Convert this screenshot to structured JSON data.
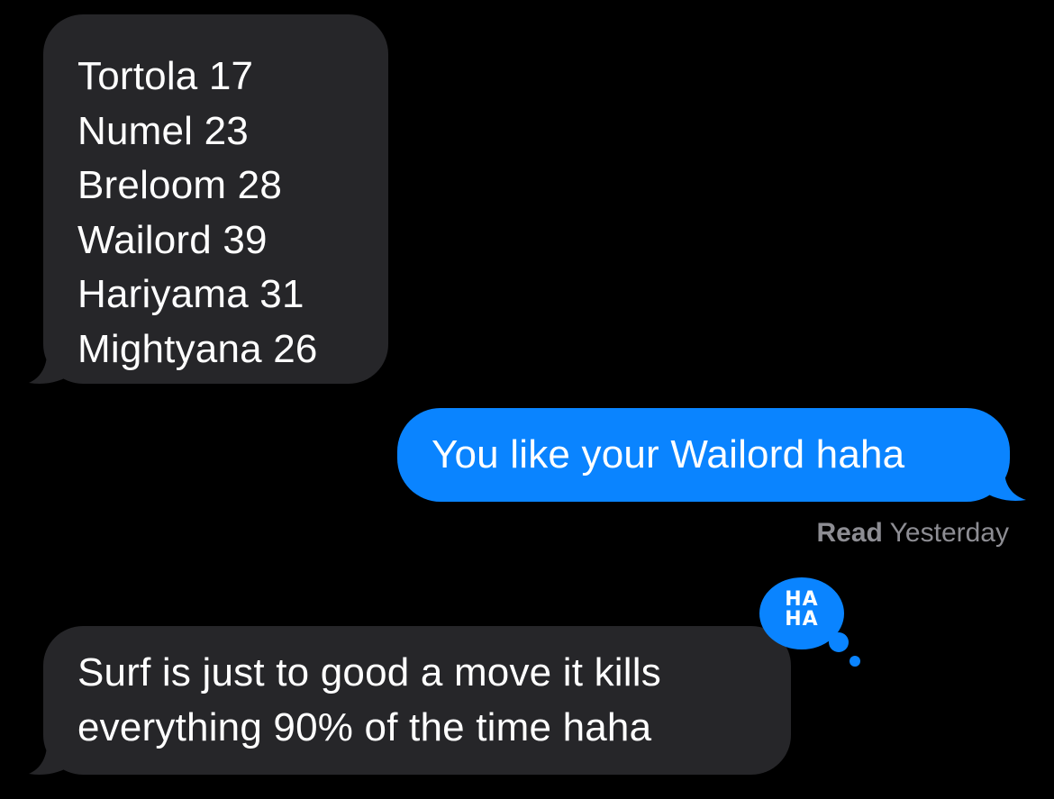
{
  "messages": {
    "list": {
      "lines": [
        "Tortola 17",
        "Numel 23",
        "Breloom 28",
        "Wailord 39",
        "Hariyama 31",
        "Mightyana 26"
      ]
    },
    "sent": {
      "text": "You like your Wailord haha"
    },
    "read_receipt": {
      "status": "Read",
      "time": "Yesterday"
    },
    "tapback": {
      "line1": "HA",
      "line2": "HA"
    },
    "reply": {
      "lines": [
        "Surf is just to good a move it kills",
        "everything 90% of the time haha"
      ]
    }
  },
  "colors": {
    "background": "#000000",
    "received_bubble": "#262629",
    "sent_bubble": "#0a84ff",
    "receipt_text": "#8d8d93"
  },
  "icons": {
    "tapback": "haha-tapback-icon"
  }
}
